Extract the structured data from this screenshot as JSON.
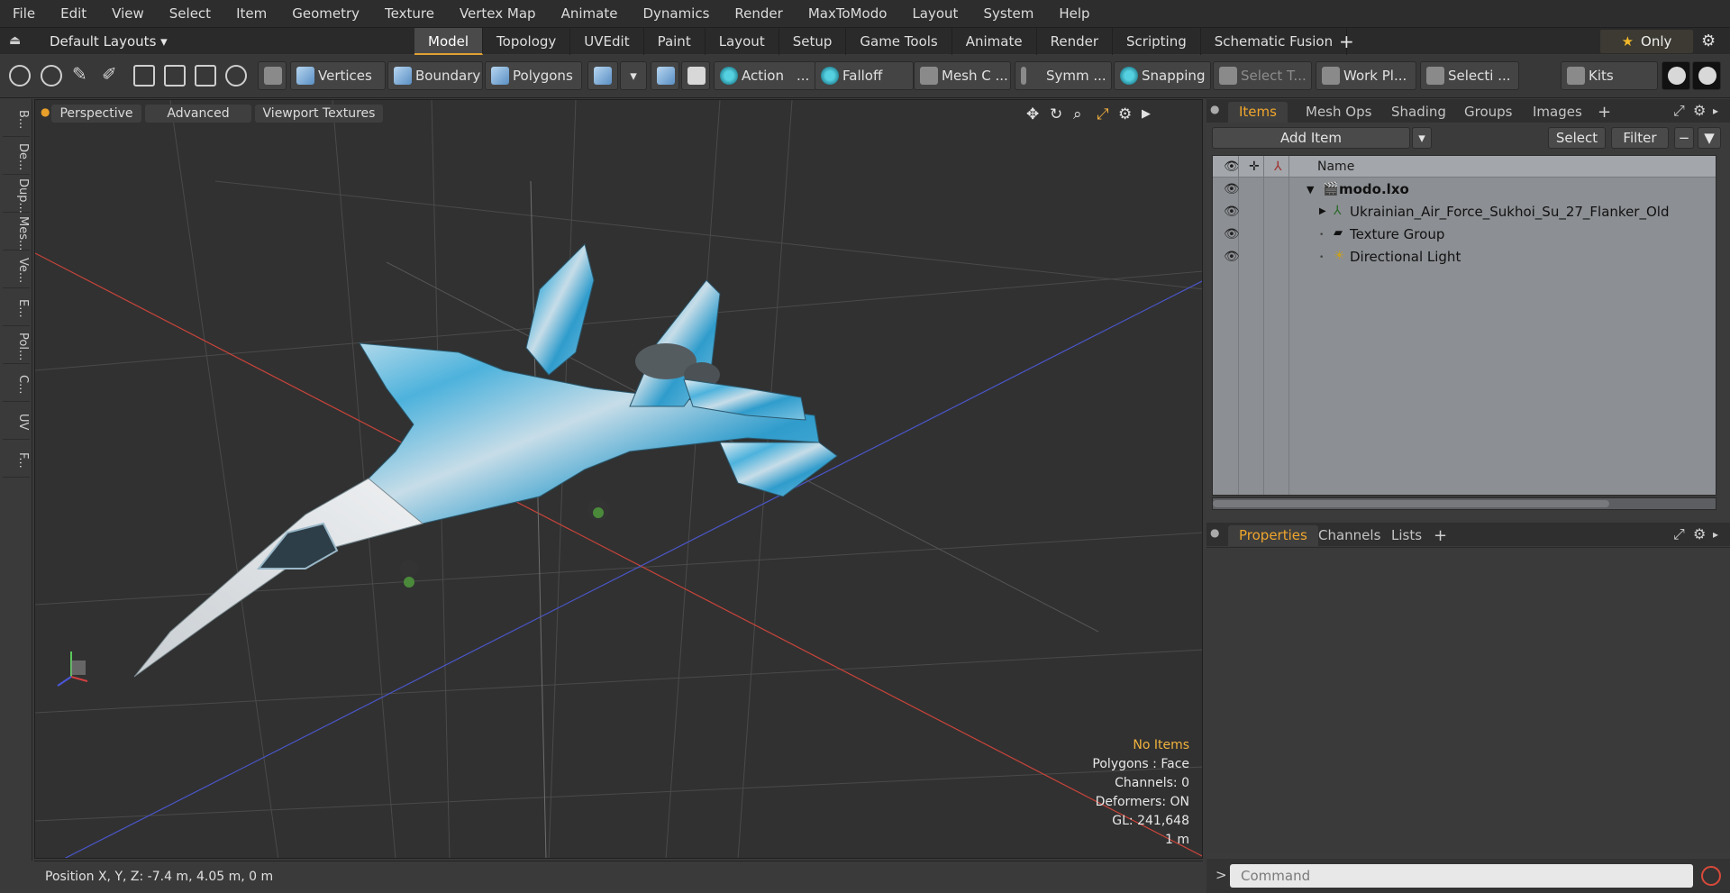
{
  "menu": [
    "File",
    "Edit",
    "View",
    "Select",
    "Item",
    "Geometry",
    "Texture",
    "Vertex Map",
    "Animate",
    "Dynamics",
    "Render",
    "MaxToModo",
    "Layout",
    "System",
    "Help"
  ],
  "layout": {
    "name": "Default Layouts ▾",
    "tabs": [
      "Model",
      "Topology",
      "UVEdit",
      "Paint",
      "Layout",
      "Setup",
      "Game Tools",
      "Animate",
      "Render",
      "Scripting",
      "Schematic Fusion"
    ],
    "active_tab": "Model",
    "add": "+",
    "only_star": "★",
    "only_label": "Only"
  },
  "toolbar": {
    "vertices": "Vertices",
    "boundary": "Boundary",
    "polygons": "Polygons",
    "action": "Action",
    "action_more": "...",
    "falloff": "Falloff",
    "mesh": "Mesh C ...",
    "symm": "Symm ...",
    "snapping": "Snapping",
    "select_t": "Select T...",
    "work_plane": "Work Pl...",
    "selecti": "Selecti ...",
    "kits": "Kits"
  },
  "left_strip": [
    "B...",
    "De...",
    "Dup...",
    "Mes...",
    "Ve...",
    "E...",
    "Pol...",
    "C...",
    "UV",
    "F..."
  ],
  "viewport": {
    "perspective": "Perspective",
    "advanced": "Advanced",
    "textures": "Viewport Textures",
    "stats": {
      "no_items": "No Items",
      "polygons": "Polygons : Face",
      "channels": "Channels: 0",
      "deformers": "Deformers: ON",
      "gl": "GL: 241,648",
      "scale": "1 m"
    }
  },
  "status": {
    "position": "Position X, Y, Z:   -7.4 m, 4.05 m, 0 m"
  },
  "items_panel": {
    "tabs": [
      "Items",
      "Mesh Ops",
      "Shading",
      "Groups",
      "Images"
    ],
    "active_tab": "Items",
    "add_item": "Add Item",
    "select": "Select",
    "filter": "Filter",
    "col_name": "Name",
    "rows": [
      {
        "label": "modo.lxo",
        "bold": true
      },
      {
        "label": "Ukrainian_Air_Force_Sukhoi_Su_27_Flanker_Old",
        "bold": false
      },
      {
        "label": "Texture Group",
        "bold": false
      },
      {
        "label": "Directional Light",
        "bold": false
      }
    ]
  },
  "props_panel": {
    "tabs": [
      "Properties",
      "Channels",
      "Lists"
    ],
    "active_tab": "Properties"
  },
  "command": {
    "prompt": ">",
    "placeholder": "Command"
  },
  "colors": {
    "accent": "#f0a62c",
    "x_axis": "#d8403a",
    "z_axis": "#4a58d8",
    "jet_camo_light": "#d8e8f0",
    "jet_camo_blue": "#3aa8d8"
  }
}
